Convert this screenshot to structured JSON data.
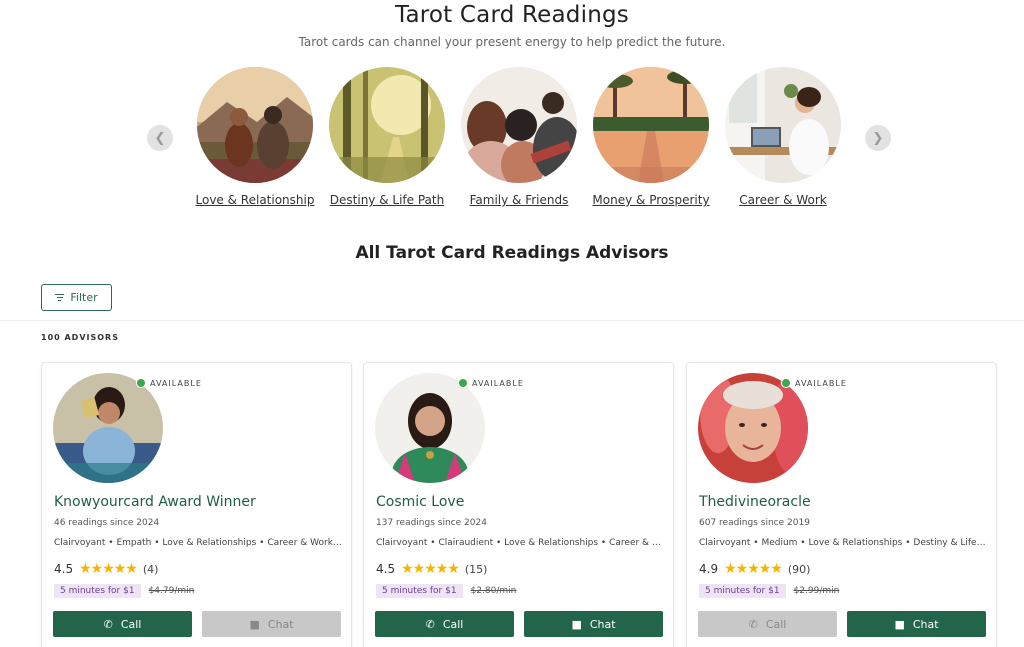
{
  "header": {
    "title": "Tarot Card Readings",
    "subtitle": "Tarot cards can channel your present energy to help predict the future."
  },
  "carousel": {
    "prev_icon": "chevron-left-icon",
    "next_icon": "chevron-right-icon",
    "categories": [
      {
        "label": "Love & Relationship"
      },
      {
        "label": "Destiny & Life Path"
      },
      {
        "label": "Family & Friends"
      },
      {
        "label": "Money & Prosperity"
      },
      {
        "label": "Career & Work"
      }
    ]
  },
  "advisors_section": {
    "title": "All Tarot Card Readings Advisors",
    "filter_label": "Filter",
    "count_label": "100 ADVISORS"
  },
  "colors": {
    "brand_green": "#23654a",
    "available_green": "#3aa84f",
    "star": "#f5b400",
    "promo_bg": "#efe3f6"
  },
  "advisors": [
    {
      "status": "AVAILABLE",
      "name": "Knowyourcard Award Winner",
      "since": "46 readings since 2024",
      "tags": "Clairvoyant • Empath • Love & Relationships • Career & Work •...",
      "rating": "4.5",
      "stars": "★★★★★",
      "reviews": "(4)",
      "promo": "5 minutes for $1",
      "old_price": "$4.79/min",
      "call_label": "Call",
      "chat_label": "Chat",
      "call_enabled": true,
      "chat_enabled": false
    },
    {
      "status": "AVAILABLE",
      "name": "Cosmic Love",
      "since": "137 readings since 2024",
      "tags": "Clairvoyant • Clairaudient • Love & Relationships • Career & W...",
      "rating": "4.5",
      "stars": "★★★★★",
      "reviews": "(15)",
      "promo": "5 minutes for $1",
      "old_price": "$2.80/min",
      "call_label": "Call",
      "chat_label": "Chat",
      "call_enabled": true,
      "chat_enabled": true
    },
    {
      "status": "AVAILABLE",
      "name": "Thedivineoracle",
      "since": "607 readings since 2019",
      "tags": "Clairvoyant • Medium • Love & Relationships • Destiny & Life Pa...",
      "rating": "4.9",
      "stars": "★★★★★",
      "reviews": "(90)",
      "promo": "5 minutes for $1",
      "old_price": "$2.99/min",
      "call_label": "Call",
      "chat_label": "Chat",
      "call_enabled": false,
      "chat_enabled": true
    }
  ]
}
